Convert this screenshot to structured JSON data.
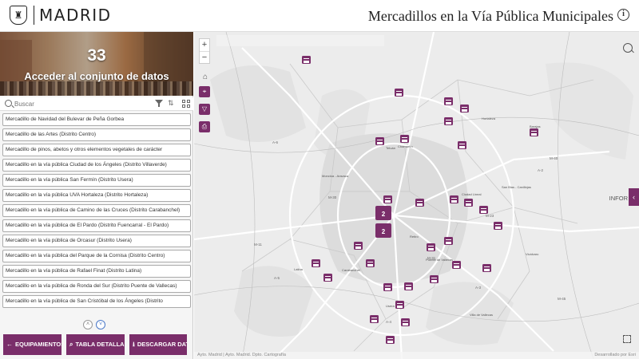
{
  "header": {
    "logo_text": "MADRID",
    "title": "Mercadillos en la Vía Pública Municipales",
    "info_icon": "ⓘ"
  },
  "banner": {
    "count": "33",
    "link_text": "Acceder al conjunto de datos"
  },
  "search": {
    "placeholder": "Buscar"
  },
  "list": [
    "Mercadillo de Navidad del Bulevar de Peña Gorbea",
    "Mercadillo de las Artes (Distrito Centro)",
    "Mercadillo de pinos, abetos y otros elementos vegetales de carácter",
    "Mercadillo en la vía pública Ciudad de los Ángeles (Distrito Villaverde)",
    "Mercadillo en la vía pública San Fermín (Distrito Usera)",
    "Mercadillo en la vía pública UVA Hortaleza (Distrito Hortaleza)",
    "Mercadillo en la vía pública de Camino de las Cruces (Distrito Carabanchel)",
    "Mercadillo en la vía pública de El Pardo (Distrito Fuencarral - El Pardo)",
    "Mercadillo en la vía pública de Orcasur (Distrito Usera)",
    "Mercadillo en la vía pública del Parque de la Cornisa (Distrito Centro)",
    "Mercadillo en la vía pública de Rafael Finat (Distrito Latina)",
    "Mercadillo en la vía pública de Ronda del Sur (Distrito Puente de Vallecas)",
    "Mercadillo en la vía pública de San Cristóbal de los Ángeles (Distrito"
  ],
  "pager": {
    "up": "˄",
    "down": "˅"
  },
  "actions": {
    "equipamientos": "EQUIPAMIENTOS",
    "tabla": "TABLA DETALLADA",
    "descargar": "DESCARGAR DATOS"
  },
  "map": {
    "zoom_in": "+",
    "zoom_out": "−",
    "info_tab": "INFOR",
    "attribution_left": "Ayto. Madrid | Ayto. Madrid. Dpto. Cartografía",
    "attribution_right": "Desarrollado por Esri",
    "accent_color": "#7a2e6a",
    "cluster_labels": [
      "2",
      "2"
    ],
    "place_labels": [
      "Tetuán",
      "Chamartín",
      "Moncloa - Aravaca",
      "Ciudad Lineal",
      "San Blas - Canillejas",
      "Retiro",
      "Latina",
      "Carabanchel",
      "Usera",
      "Puente de Vallecas",
      "Villa de Vallecas",
      "Vicálvaro",
      "Hortaleza",
      "Barajas"
    ],
    "road_labels": [
      "A-6",
      "M-30",
      "M-40",
      "A-2",
      "M-11",
      "A-5",
      "A-4",
      "A-3",
      "M-23",
      "M-45",
      "M-31"
    ]
  }
}
